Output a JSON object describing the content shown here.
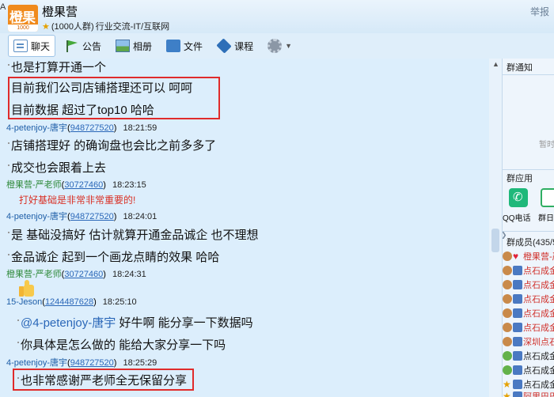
{
  "window": {
    "corner_letter": "A",
    "group_name": "橙果营",
    "member_count": "(1000人群)",
    "categories": "行业交流-IT/互联网",
    "report_label": "举报",
    "logo_text": "橙果",
    "logo_sub": "1000"
  },
  "toolbar": {
    "items": [
      {
        "label": "聊天",
        "icon": "chat-icon"
      },
      {
        "label": "公告",
        "icon": "flag-icon"
      },
      {
        "label": "相册",
        "icon": "photo-icon"
      },
      {
        "label": "文件",
        "icon": "folder-icon"
      },
      {
        "label": "课程",
        "icon": "course-icon"
      }
    ],
    "settings_icon": "gear-icon"
  },
  "chat": {
    "lines": [
      {
        "text": "也是打算开通一个"
      },
      {
        "text": "目前我们公司店铺搭理还可以 呵呵"
      },
      {
        "text": "目前数据 超过了top10 哈哈"
      },
      {
        "sender": "4-petenjoy-唐宇",
        "qq": "948727520",
        "time": "18:21:59"
      },
      {
        "text": "店铺搭理好 的确询盘也会比之前多多了"
      },
      {
        "text": "成交也会跟着上去"
      },
      {
        "sender": "橙果营-严老师",
        "qq": "30727460",
        "time": "18:23:15"
      },
      {
        "text": "打好基础是非常非常重要的!"
      },
      {
        "sender": "4-petenjoy-唐宇",
        "qq": "948727520",
        "time": "18:24:01"
      },
      {
        "text": "是 基础没搞好 估计就算开通金品诚企 也不理想"
      },
      {
        "text": "金品诚企 起到一个画龙点睛的效果 哈哈"
      },
      {
        "sender": "橙果营-严老师",
        "qq": "30727460",
        "time": "18:24:31"
      },
      {
        "sender": "15-Jeson",
        "qq": "1244487628",
        "time": "18:25:10"
      },
      {
        "mention": "@4-petenjoy-唐宇",
        "text": " 好牛啊 能分享一下数据吗"
      },
      {
        "text": "你具体是怎么做的 能给大家分享一下吗"
      },
      {
        "sender": "4-petenjoy-唐宇",
        "qq": "948727520",
        "time": "18:25:29"
      },
      {
        "text": "也非常感谢严老师全无保留分享"
      }
    ]
  },
  "right_panel": {
    "notice_title": "群通知",
    "notice_text": "暂时",
    "apps_title": "群应用",
    "apps": [
      {
        "label": "QQ电话",
        "icon": "phone-icon"
      },
      {
        "label": "群日",
        "icon": "calendar-icon"
      }
    ],
    "members_title": "群成员(435/5",
    "members": [
      {
        "name": "橙果营-严"
      },
      {
        "name": "点石成金"
      },
      {
        "name": "点石成金"
      },
      {
        "name": "点石成金"
      },
      {
        "name": "点石成金"
      },
      {
        "name": "点石成金"
      },
      {
        "name": "深圳点石"
      },
      {
        "name": "点石成金"
      },
      {
        "name": "点石成金"
      },
      {
        "name": "点石成金"
      },
      {
        "name": "阿里巴巴"
      }
    ]
  },
  "colors": {
    "highlight_border": "#e02b2b",
    "sender_blue": "#1f5fa8",
    "teacher_green": "#2f8a3a",
    "red_text": "#d93025",
    "chat_bg": "#dceefc"
  }
}
